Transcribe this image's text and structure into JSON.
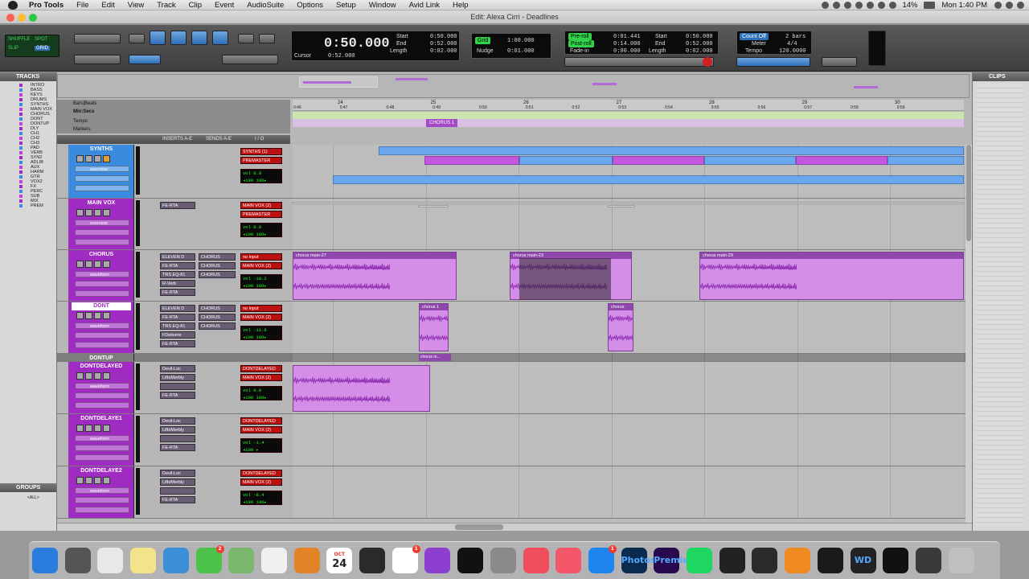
{
  "menubar": {
    "app": "Pro Tools",
    "items": [
      "File",
      "Edit",
      "View",
      "Track",
      "Clip",
      "Event",
      "AudioSuite",
      "Options",
      "Setup",
      "Window",
      "Avid Link",
      "Help"
    ],
    "battery": "14%",
    "clock": "Mon 1:40 PM"
  },
  "window": {
    "title": "Edit: Alexa Cirri - Deadlines"
  },
  "toolbar": {
    "edit_modes": [
      "SHUFFLE",
      "SPOT",
      "SLIP",
      "GRID"
    ],
    "main_counter": "0:50.000",
    "sub_counter_label": "Cursor",
    "sub_counter": "0:52.000",
    "selection": {
      "start_label": "Start",
      "start": "0:50.000",
      "end_label": "End",
      "end": "0:52.000",
      "length_label": "Length",
      "length": "0:02.000"
    },
    "grid_value": "1:00.000",
    "nudge_label": "Nudge",
    "nudge_value": "0:01.000",
    "grid_label": "Grid",
    "transport_counters": {
      "start_label": "Start",
      "start": "0:01.441",
      "end_label": "End",
      "end": "0:14.000",
      "length_label": "Length",
      "length": "0:00.000"
    },
    "preroll_label": "Pre-roll",
    "postroll_label": "Post-roll",
    "fadein_label": "Fade-in",
    "count_off_label": "Count Off",
    "count_off_value": "2 bars",
    "meter_label": "Meter",
    "meter_value": "4/4",
    "tempo_label": "Tempo",
    "tempo_value": "120.0000"
  },
  "panels": {
    "tracks_title": "TRACKS",
    "groups_title": "GROUPS",
    "groups_item": "<ALL>",
    "clips_title": "CLIPS"
  },
  "ruler": {
    "rows": [
      "Bars|Beats",
      "Min:Secs",
      "Tempo",
      "Markers"
    ],
    "bars": [
      "24",
      "25",
      "26",
      "27",
      "28",
      "29",
      "30"
    ],
    "times": [
      "0:46",
      "0:47",
      "0:48",
      "0:49",
      "0:50",
      "0:51",
      "0:52",
      "0:53",
      "0:54",
      "0:55",
      "0:56",
      "0:57",
      "0:58",
      "0:59"
    ],
    "marker": "CHORUS 1"
  },
  "column_headers": {
    "inserts": "INSERTS A-E",
    "sends": "SENDS A-E",
    "io": "I / O"
  },
  "tracks": [
    {
      "name": "SYNTHS",
      "color": "#3a8be0",
      "view": "overview",
      "inserts": [],
      "sends": [],
      "io_in": "SYNTHS (1)",
      "io_out": "PREMASTER",
      "vol": "vol 0.0",
      "pan": "◂100 100▸"
    },
    {
      "name": "MAIN VOX",
      "color": "#a02bc3",
      "view": "overview",
      "inserts": [
        "FE-RTA"
      ],
      "sends": [],
      "io_in": "MAIN VOX (2)",
      "io_out": "PREMASTER",
      "vol": "vol 0.0",
      "pan": "◂100 100▸"
    },
    {
      "name": "CHORUS",
      "color": "#a02bc3",
      "view": "waveform",
      "inserts": [
        "ELEVEN D",
        "FE-RTA",
        "TRS EQ-81",
        "R-Verb",
        "FE-RTA"
      ],
      "sends": [
        "CHORUS",
        "CHORUS",
        "CHORUS"
      ],
      "io_in": "no input",
      "io_out": "MAIN VOX (2)",
      "vol": "vol -10.2",
      "pan": "◂100 100▸"
    },
    {
      "name": "DONT",
      "color": "#a02bc3",
      "view": "waveform",
      "inserts": [
        "ELEVEN D",
        "FE-RTA",
        "TRS EQ-81",
        "FDelivere",
        "FE-RTA"
      ],
      "sends": [
        "CHORUS",
        "CHORUS",
        "CHORUS"
      ],
      "io_in": "no input",
      "io_out": "MAIN VOX (2)",
      "vol": "vol -11.6",
      "pan": "◂100 100▸"
    },
    {
      "name": "DONTUP",
      "color": "#7d7d7d",
      "view": "",
      "inserts": [],
      "sends": [],
      "io_in": "",
      "io_out": "",
      "vol": "",
      "pan": ""
    },
    {
      "name": "DONTDELAYED",
      "color": "#a02bc3",
      "view": "waveform",
      "inserts": [
        "Devil-Loc",
        "LiftoMerbly",
        "",
        "FE-RTA"
      ],
      "sends": [],
      "io_in": "DONTDELAYED",
      "io_out": "MAIN VOX (2)",
      "vol": "vol 0.0",
      "pan": "◂100 100▸"
    },
    {
      "name": "DONTDELAYE1",
      "color": "#a02bc3",
      "view": "waveform",
      "inserts": [
        "Devil-Loc",
        "LiftoMerbly",
        "",
        "FE-RTA"
      ],
      "sends": [],
      "io_in": "DONTDELAYED",
      "io_out": "MAIN VOX (2)",
      "vol": "vol -1.4",
      "pan": "◂100 ▸"
    },
    {
      "name": "DONTDELAYE2",
      "color": "#a02bc3",
      "view": "waveform",
      "inserts": [
        "Devil-Loc",
        "LiftoMerbly",
        "",
        "FE-RTA"
      ],
      "sends": [],
      "io_in": "DONTDELAYED",
      "io_out": "MAIN VOX (2)",
      "vol": "vol -8.4",
      "pan": "◂100 100▸"
    }
  ],
  "clips": {
    "chorus_a": "chorus main-27",
    "chorus_b": "chorus main-23",
    "chorus_c": "chorus main-29",
    "dont_a": "chorus 1",
    "dont_b": "chorus",
    "dontup": "chorus m..."
  },
  "dock": [
    "Finder",
    "Launchpad",
    "Chrome",
    "Notes",
    "Preview",
    "Messages",
    "Maps",
    "Photos",
    "Books",
    "Calendar",
    "Siri",
    "Reminders",
    "Podcasts",
    "TV",
    "System Preferences",
    "News",
    "Music",
    "App Store",
    "Photoshop",
    "Premiere",
    "Spotify",
    "Logic",
    "Pro Tools",
    "FL Studio",
    "Waves",
    "WD",
    "Terminal",
    "Keyboard",
    "Trash"
  ],
  "dock_badges": {
    "messages": "2",
    "calendar_day": "24",
    "reminders": "1",
    "app_store": "1",
    "calendar_month": "OCT"
  },
  "colors": {
    "accent_purple": "#a02bc3",
    "clip_purple": "#d48ee8",
    "synth_blue": "#3a8be0",
    "counter_green": "#32d34a"
  }
}
